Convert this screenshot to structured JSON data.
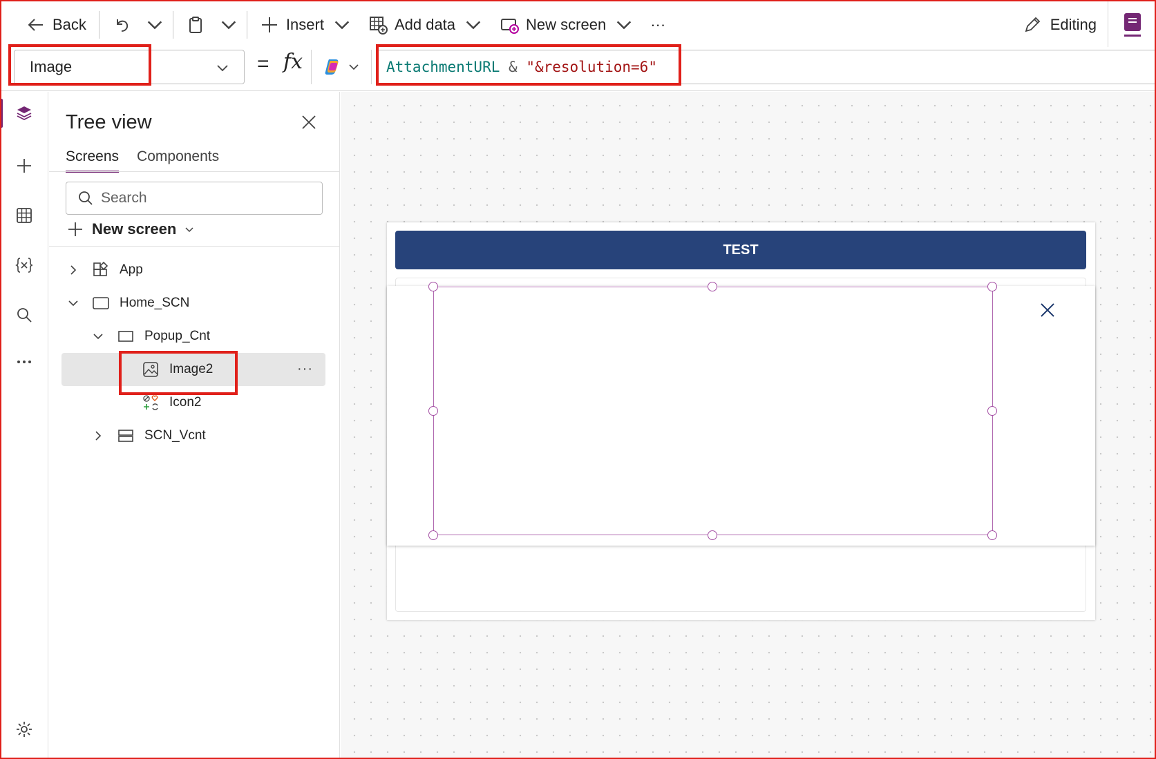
{
  "toolbar": {
    "back_label": "Back",
    "insert_label": "Insert",
    "add_data_label": "Add data",
    "new_screen_label": "New screen",
    "more_label": "···",
    "editing_label": "Editing"
  },
  "formula_bar": {
    "property": "Image",
    "equals": "=",
    "fx": "fx",
    "formula": {
      "identifier": "AttachmentURL",
      "operator": " & ",
      "string": "\"&resolution=6\""
    }
  },
  "tree_view": {
    "title": "Tree view",
    "tabs": [
      {
        "label": "Screens",
        "active": true
      },
      {
        "label": "Components",
        "active": false
      }
    ],
    "search_placeholder": "Search",
    "new_screen_label": "New screen",
    "nodes": [
      {
        "label": "App",
        "icon": "app-icon",
        "expanded": false
      },
      {
        "label": "Home_SCN",
        "icon": "screen-icon",
        "expanded": true
      },
      {
        "label": "Popup_Cnt",
        "icon": "container-icon",
        "expanded": true
      },
      {
        "label": "Image2",
        "icon": "image-icon",
        "selected": true
      },
      {
        "label": "Icon2",
        "icon": "icons-icon"
      },
      {
        "label": "SCN_Vcnt",
        "icon": "vertical-container-icon",
        "expanded": false
      }
    ]
  },
  "canvas": {
    "header_text": "TEST"
  },
  "colors": {
    "accent": "#742774",
    "header_bar": "#27437a",
    "highlight": "#e0201a",
    "selection": "#a44fa4"
  }
}
